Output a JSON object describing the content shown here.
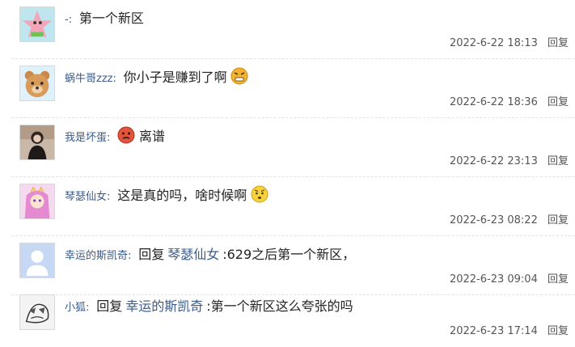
{
  "comments": [
    {
      "user": "-",
      "text": "第一个新区",
      "time": "2022-6-22 18:13",
      "reply_label": "回复"
    },
    {
      "user": "蜗牛哥zzz",
      "text": "你小子是赚到了啊",
      "time": "2022-6-22 18:36",
      "reply_label": "回复",
      "emoji": "angry-face-emoji"
    },
    {
      "user": "我是坏蛋",
      "text": "离谱",
      "time": "2022-6-22 23:13",
      "reply_label": "回复",
      "emoji": "red-face-emoji"
    },
    {
      "user": "琴瑟仙女",
      "text": "这是真的吗，啥时候啊",
      "time": "2022-6-23 08:22",
      "reply_label": "回复",
      "emoji": "worried-face-emoji"
    },
    {
      "user": "幸运的斯凯奇",
      "reply_prefix": "回复",
      "reply_to": "琴瑟仙女",
      "text": ":629之后第一个新区，",
      "time": "2022-6-23 09:04",
      "reply_label": "回复"
    },
    {
      "user": "小狐",
      "reply_prefix": "回复",
      "reply_to": "幸运的斯凯奇",
      "text": ":第一个新区这么夸张的吗",
      "time": "2022-6-23 17:14",
      "reply_label": "回复"
    }
  ],
  "colors": {
    "username": "#3b5b8a",
    "meta": "#555555",
    "divider": "#e3e3e3"
  }
}
